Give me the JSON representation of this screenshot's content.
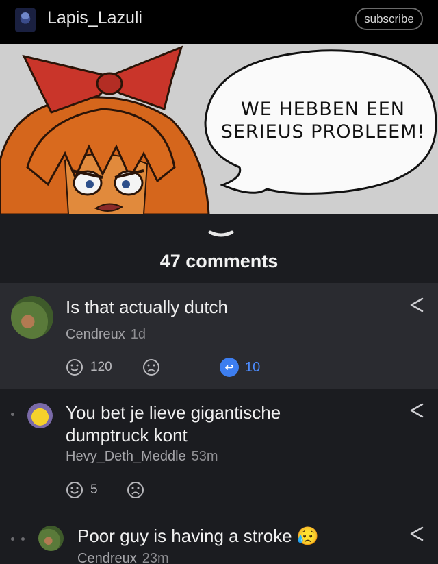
{
  "header": {
    "username": "Lapis_Lazuli",
    "subscribe_label": "subscribe"
  },
  "post": {
    "speech_line1": "WE HEBBEN EEN",
    "speech_line2": "SERIEUS PROBLEEM!",
    "comment_count_label": "47 comments"
  },
  "comments": [
    {
      "text": "Is that actually dutch",
      "author": "Cendreux",
      "time": "1d",
      "upvotes": "120",
      "replies": "10",
      "reply_icon": "reply-arrow-icon"
    },
    {
      "text_line1": "You bet je lieve gigantische",
      "text_line2": "dumptruck kont",
      "author": "Hevy_Deth_Meddle",
      "time": "53m",
      "upvotes": "5"
    },
    {
      "text": "Poor guy is having a stroke",
      "emoji": "😥",
      "author": "Cendreux",
      "time": "23m"
    }
  ],
  "colors": {
    "background": "#1b1c20",
    "highlight_comment": "#2a2b30",
    "reply_accent": "#3d7ef0"
  }
}
